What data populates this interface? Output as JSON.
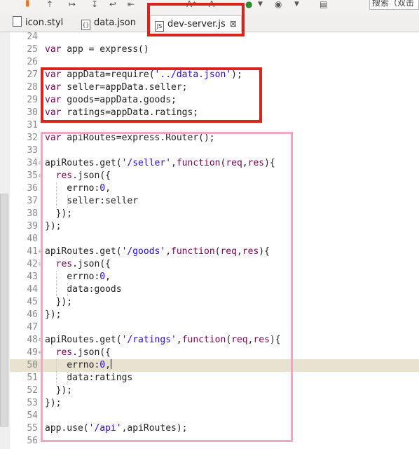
{
  "toolbar": {
    "icons": [
      "bookmark-icon",
      "upload-icon",
      "step-icon",
      "step-icon",
      "back-icon",
      "a-plus-icon",
      "a-minus-icon",
      "run-icon",
      "dropdown-icon",
      "globe-icon",
      "dropdown-icon",
      "book-icon"
    ],
    "search_text": "搜索（双击"
  },
  "tabs": [
    {
      "label": "icon.styl",
      "icon": "file-icon",
      "active": false
    },
    {
      "label": "data.json",
      "icon": "json-icon",
      "active": false
    },
    {
      "label": "dev-server.js",
      "icon": "js-icon",
      "active": true
    }
  ],
  "editor": {
    "lines": [
      {
        "n": "24",
        "text": ""
      },
      {
        "n": "25",
        "text": "var app = express()"
      },
      {
        "n": "26",
        "text": ""
      },
      {
        "n": "27",
        "text": "var appData=require('../data.json');"
      },
      {
        "n": "28",
        "text": "var seller=appData.seller;"
      },
      {
        "n": "29",
        "text": "var goods=appData.goods;"
      },
      {
        "n": "30",
        "text": "var ratings=appData.ratings;"
      },
      {
        "n": "31",
        "text": ""
      },
      {
        "n": "32",
        "text": "var apiRoutes=express.Router();"
      },
      {
        "n": "33",
        "text": ""
      },
      {
        "n": "34",
        "text": "apiRoutes.get('/seller',function(req,res){"
      },
      {
        "n": "35",
        "text": "  res.json({"
      },
      {
        "n": "36",
        "text": "    errno:0,"
      },
      {
        "n": "37",
        "text": "    seller:seller"
      },
      {
        "n": "38",
        "text": "  });"
      },
      {
        "n": "39",
        "text": "});"
      },
      {
        "n": "40",
        "text": ""
      },
      {
        "n": "41",
        "text": "apiRoutes.get('/goods',function(req,res){"
      },
      {
        "n": "42",
        "text": "  res.json({"
      },
      {
        "n": "43",
        "text": "    errno:0,"
      },
      {
        "n": "44",
        "text": "    data:goods"
      },
      {
        "n": "45",
        "text": "  });"
      },
      {
        "n": "46",
        "text": "});"
      },
      {
        "n": "47",
        "text": ""
      },
      {
        "n": "48",
        "text": "apiRoutes.get('/ratings',function(req,res){"
      },
      {
        "n": "49",
        "text": "  res.json({"
      },
      {
        "n": "50",
        "text": "    errno:0,"
      },
      {
        "n": "51",
        "text": "    data:ratings"
      },
      {
        "n": "52",
        "text": "  });"
      },
      {
        "n": "53",
        "text": "});"
      },
      {
        "n": "54",
        "text": ""
      },
      {
        "n": "55",
        "text": "app.use('/api',apiRoutes);"
      },
      {
        "n": "56",
        "text": ""
      }
    ],
    "current_line": "50"
  },
  "colors": {
    "keyword": "#7f0055",
    "string": "#2a00ff",
    "current_line_bg": "#e8e2d0",
    "annotation_red": "#d9231d",
    "annotation_pink": "#f0a7c4"
  }
}
